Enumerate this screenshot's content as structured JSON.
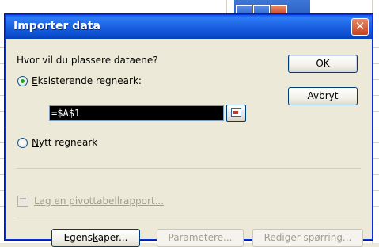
{
  "dialog": {
    "title": "Importer data",
    "question": "Hvor vil du plassere dataene?",
    "option_existing": {
      "accel": "E",
      "rest": "ksisterende regneark:"
    },
    "reference_value": "=$A$1",
    "option_new": {
      "accel": "N",
      "rest": "ytt regneark"
    },
    "pivot_link": "Lag en pivottabellrapport...",
    "buttons": {
      "ok": "OK",
      "cancel": "Avbryt",
      "properties": {
        "pre": "Egens",
        "accel": "k",
        "post": "aper..."
      },
      "parameters": "Parametere...",
      "edit_query": "Rediger spørring..."
    },
    "selected_option": "existing"
  },
  "icons": {
    "close": "close-icon",
    "reference_picker": "collapse-dialog-icon",
    "pivot": "pivot-table-icon"
  },
  "colors": {
    "title_bar": "#0a5fe8",
    "face": "#ece9d8",
    "ref_box_bg": "#000000",
    "close": "#c9431c"
  }
}
